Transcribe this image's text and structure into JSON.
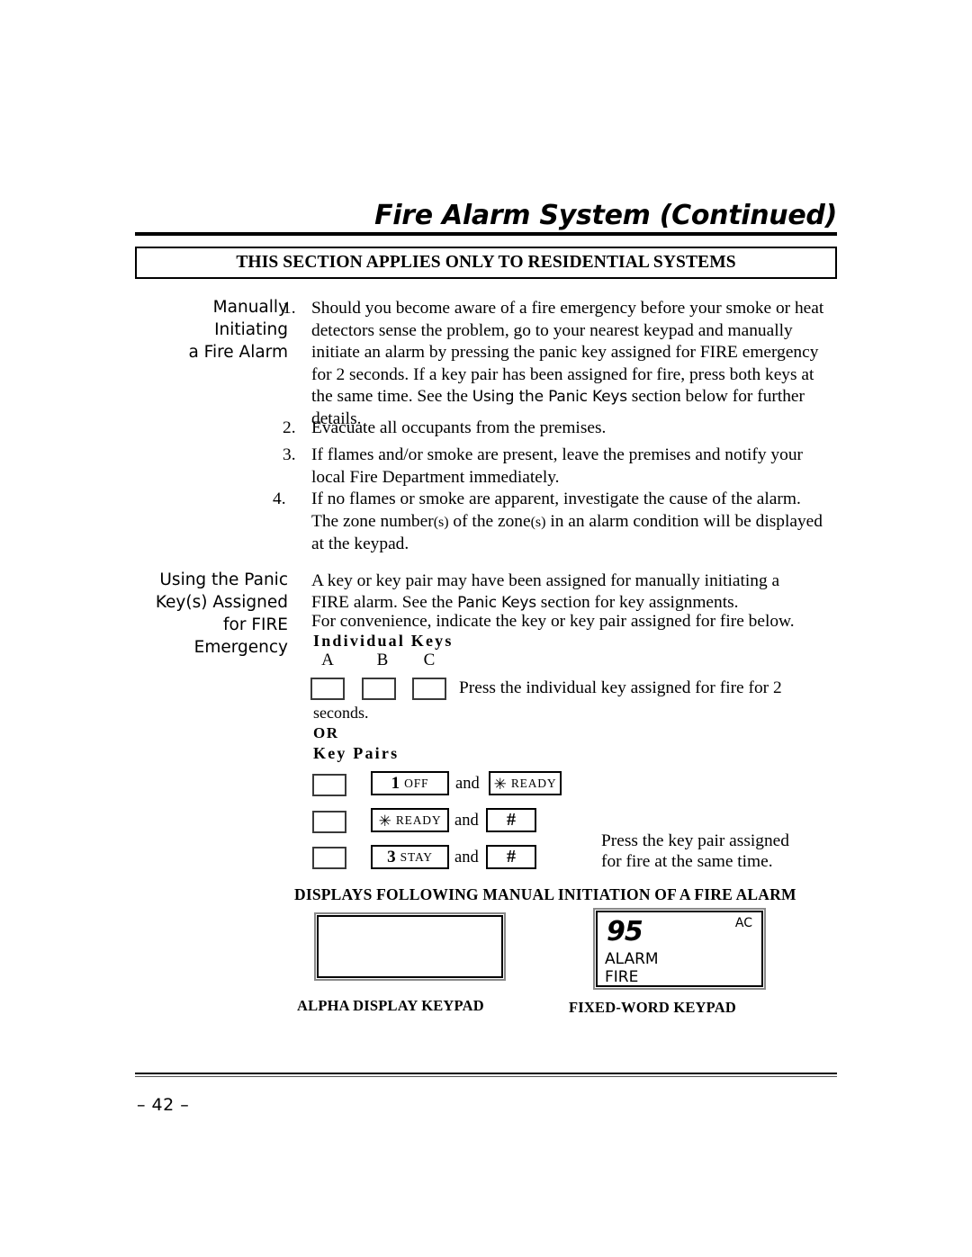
{
  "header": {
    "title": "Fire Alarm System (Continued)",
    "banner": "THIS SECTION APPLIES ONLY TO RESIDENTIAL SYSTEMS"
  },
  "section1": {
    "side_label": "Manually\nInitiating\na Fire Alarm",
    "items": [
      {
        "marker": "1.",
        "text_before": "Should you become aware of a fire emergency before your smoke or heat detectors sense the problem, go to your nearest keypad and manually initiate an alarm by pressing the panic key assigned for FIRE emergency for 2 seconds. If a key pair has been assigned for fire, press both keys at the same time. See the ",
        "emphasis": "Using the Panic Keys",
        "text_after": " section below for further details."
      },
      {
        "marker": "2.",
        "text_before": "Evacuate all occupants from the premises.",
        "emphasis": "",
        "text_after": ""
      },
      {
        "marker": "3.",
        "text_before": "If flames and/or smoke are present, leave the premises and notify your local Fire Department immediately.",
        "emphasis": "",
        "text_after": ""
      },
      {
        "marker": "4.",
        "text_before": "If no flames or smoke are apparent, investigate the cause of the alarm. The zone number",
        "paren1": "(s)",
        "mid1": " of the zone",
        "paren2": "(s)",
        "mid2": " in an alarm condition will be displayed at the keypad."
      }
    ]
  },
  "section2": {
    "side_label": "Using the Panic\nKey(s) Assigned\nfor FIRE\nEmergency",
    "line1_before": "A key or key pair may have been assigned for manually initiating a",
    "line2_before": "FIRE alarm. See the ",
    "line2_emphasis": "Panic Keys",
    "line2_after": " section for key assignments.",
    "line3": "For convenience, indicate the key or key pair assigned for fire below.",
    "individual_keys_heading": "Individual Keys",
    "letters": [
      "A",
      "B",
      "C"
    ],
    "press_individual": "Press  the individual key assigned for fire for 2",
    "seconds_text": "seconds.",
    "or_heading": "OR",
    "key_pairs_heading": "Key Pairs",
    "and_word": "and",
    "key_pairs": [
      {
        "left_key": {
          "number": "1",
          "word": "OFF",
          "star": false,
          "hash": false
        },
        "right_key": {
          "number": "",
          "word": "READY",
          "star": true,
          "hash": false
        }
      },
      {
        "left_key": {
          "number": "",
          "word": "READY",
          "star": true,
          "hash": false
        },
        "right_key": {
          "number": "",
          "word": "",
          "star": false,
          "hash": true,
          "hash_label": "#"
        }
      },
      {
        "left_key": {
          "number": "3",
          "word": "STAY",
          "star": false,
          "hash": false
        },
        "right_key": {
          "number": "",
          "word": "",
          "star": false,
          "hash": true,
          "hash_label": "#"
        }
      }
    ],
    "press_pair": "Press the key pair assigned for fire at the same time."
  },
  "displays": {
    "heading": "DISPLAYS FOLLOWING MANUAL INITIATION OF A FIRE ALARM",
    "alpha_display_text": "",
    "alpha_caption": "ALPHA DISPLAY KEYPAD",
    "fixed_word": {
      "digits": "95",
      "ac": "AC",
      "alarm": "ALARM",
      "fire": "FIRE"
    },
    "fixed_caption": "FIXED-WORD KEYPAD"
  },
  "footer": {
    "page_number": "– 42 –"
  },
  "star_glyph": "✳"
}
